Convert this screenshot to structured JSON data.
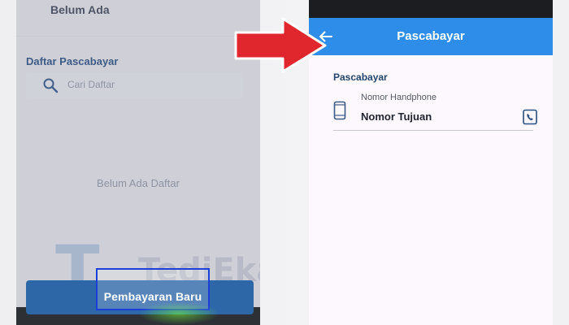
{
  "left_screen": {
    "prev_title": "Belum Ada",
    "section_title": "Daftar Pascabayar",
    "search_placeholder": "Cari Daftar",
    "empty_text": "Belum Ada Daftar",
    "new_payment_button": "Pembayaran Baru",
    "watermark_letter": "T",
    "watermark_text": "TediEka.com"
  },
  "right_screen": {
    "header_title": "Pascabayar",
    "form_section_title": "Pascabayar",
    "field_label": "Nomor Handphone",
    "field_value": "Nomor Tujuan"
  },
  "colors": {
    "header_blue": "#2e8de9",
    "button_blue": "#2d67a8",
    "highlight_border": "#1b3fd9",
    "arrow_red": "#e0272e"
  },
  "icons": [
    "search-icon",
    "back-arrow-icon",
    "phone-icon",
    "contact-book-icon",
    "pointer-arrow-icon"
  ]
}
